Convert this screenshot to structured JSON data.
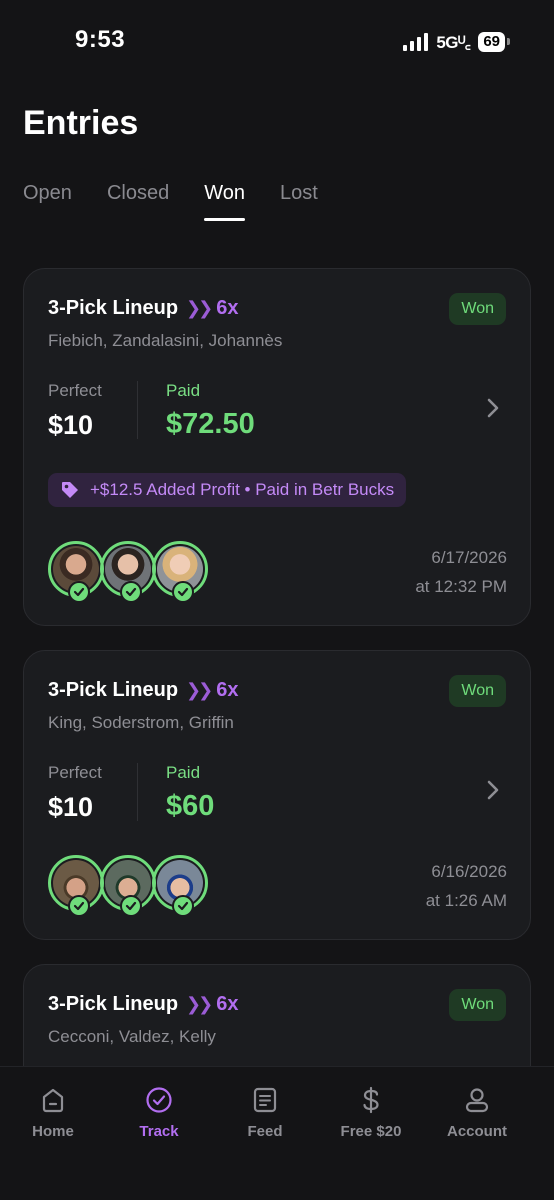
{
  "status": {
    "time": "9:53",
    "network": "5Gᵁ꜀",
    "battery": "69"
  },
  "header": {
    "title": "Entries"
  },
  "tabs": [
    {
      "label": "Open"
    },
    {
      "label": "Closed"
    },
    {
      "label": "Won"
    },
    {
      "label": "Lost"
    }
  ],
  "active_tab": "Won",
  "entries": [
    {
      "title": "3-Pick Lineup",
      "multiplier": "6x",
      "status": "Won",
      "players": "Fiebich, Zandalasini, Johannès",
      "perfect_label": "Perfect",
      "perfect_value": "$10",
      "paid_label": "Paid",
      "paid_value": "$72.50",
      "promo": "+$12.5 Added Profit • Paid in Betr Bucks",
      "date": "6/17/2026",
      "time": "at 12:32 PM"
    },
    {
      "title": "3-Pick Lineup",
      "multiplier": "6x",
      "status": "Won",
      "players": "King, Soderstrom, Griffin",
      "perfect_label": "Perfect",
      "perfect_value": "$10",
      "paid_label": "Paid",
      "paid_value": "$60",
      "date": "6/16/2026",
      "time": "at 1:26 AM"
    },
    {
      "title": "3-Pick Lineup",
      "multiplier": "6x",
      "status": "Won",
      "players": "Cecconi, Valdez, Kelly"
    }
  ],
  "nav": [
    {
      "label": "Home",
      "icon": "home-icon"
    },
    {
      "label": "Track",
      "icon": "track-check-icon"
    },
    {
      "label": "Feed",
      "icon": "feed-icon"
    },
    {
      "label": "Free $20",
      "icon": "dollar-icon"
    },
    {
      "label": "Account",
      "icon": "account-icon"
    }
  ],
  "colors": {
    "accent": "#b26ef0",
    "success": "#6fdc7b",
    "background": "#141416",
    "card": "#1b1c1f"
  }
}
